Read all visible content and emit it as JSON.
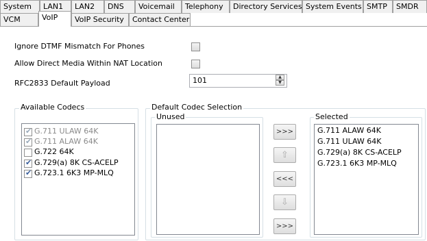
{
  "tabs": {
    "row1": [
      "System",
      "LAN1",
      "LAN2",
      "DNS",
      "Voicemail",
      "Telephony",
      "Directory Services",
      "System Events",
      "SMTP",
      "SMDR"
    ],
    "row2": [
      "VCM",
      "VoIP",
      "VoIP Security",
      "Contact Center"
    ],
    "active": "VoIP"
  },
  "settings": {
    "ignore_dtmf_label": "Ignore DTMF Mismatch For Phones",
    "allow_direct_media_label": "Allow Direct Media Within NAT Location",
    "rfc2833_label": "RFC2833 Default Payload",
    "rfc2833_value": "101"
  },
  "available_codecs": {
    "title": "Available Codecs",
    "items": [
      {
        "label": "G.711 ULAW 64K",
        "checked": true,
        "enabled": false
      },
      {
        "label": "G.711 ALAW 64K",
        "checked": true,
        "enabled": false
      },
      {
        "label": "G.722 64K",
        "checked": false,
        "enabled": true
      },
      {
        "label": "G.729(a) 8K CS-ACELP",
        "checked": true,
        "enabled": true
      },
      {
        "label": "G.723.1 6K3 MP-MLQ",
        "checked": true,
        "enabled": true
      }
    ]
  },
  "default_codec_selection": {
    "title": "Default Codec Selection",
    "unused_label": "Unused",
    "selected_label": "Selected",
    "selected_items": [
      "G.711 ALAW 64K",
      "G.711 ULAW 64K",
      "G.729(a) 8K CS-ACELP",
      "G.723.1 6K3 MP-MLQ"
    ],
    "buttons": {
      "add_all": ">>>",
      "move_up_icon": "arrow-up",
      "remove_all": "<<<",
      "move_down_icon": "arrow-down",
      "add_all_2": ">>>"
    }
  }
}
